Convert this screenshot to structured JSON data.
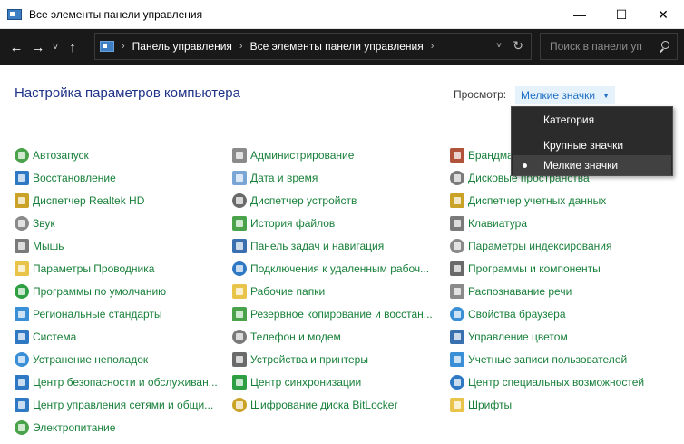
{
  "window": {
    "title": "Все элементы панели управления",
    "minimize": "—",
    "maximize": "☐",
    "close": "✕"
  },
  "address": {
    "back": "←",
    "forward": "→",
    "recent": "˅",
    "up": "↑",
    "crumbs": [
      "Панель управления",
      "Все элементы панели управления"
    ],
    "sep": "›",
    "dropdown": "˅",
    "refresh": "↻"
  },
  "search": {
    "placeholder": "Поиск в панели уп"
  },
  "header": {
    "title": "Настройка параметров компьютера",
    "view_label": "Просмотр:",
    "view_value": "Мелкие значки",
    "view_arrow": "▼"
  },
  "view_menu": {
    "items": [
      "Категория",
      "Крупные значки",
      "Мелкие значки"
    ],
    "selected": "Мелкие значки"
  },
  "columns": [
    [
      {
        "label": "Автозапуск",
        "icon": "autoplay-icon",
        "color": "#4aa34a"
      },
      {
        "label": "Восстановление",
        "icon": "recovery-icon",
        "color": "#2f78c4"
      },
      {
        "label": "Диспетчер Realtek HD",
        "icon": "realtek-audio-icon",
        "color": "#c9a227"
      },
      {
        "label": "Звук",
        "icon": "speaker-icon",
        "color": "#8a8a8a"
      },
      {
        "label": "Мышь",
        "icon": "mouse-icon",
        "color": "#7a7a7a"
      },
      {
        "label": "Параметры Проводника",
        "icon": "folder-options-icon",
        "color": "#e8c54a"
      },
      {
        "label": "Программы по умолчанию",
        "icon": "default-programs-icon",
        "color": "#2ea043"
      },
      {
        "label": "Региональные стандарты",
        "icon": "region-globe-icon",
        "color": "#3a8fd6"
      },
      {
        "label": "Система",
        "icon": "system-monitor-icon",
        "color": "#2f78c4"
      },
      {
        "label": "Устранение неполадок",
        "icon": "troubleshoot-icon",
        "color": "#3a8fd6"
      },
      {
        "label": "Центр безопасности и обслуживан...",
        "icon": "security-flag-icon",
        "color": "#2f78c4"
      },
      {
        "label": "Центр управления сетями и общи...",
        "icon": "network-icon",
        "color": "#2f78c4"
      },
      {
        "label": "Электропитание",
        "icon": "power-options-icon",
        "color": "#4aa34a"
      }
    ],
    [
      {
        "label": "Администрирование",
        "icon": "admin-tools-icon",
        "color": "#8a8a8a"
      },
      {
        "label": "Дата и время",
        "icon": "clock-icon",
        "color": "#7aa6d6"
      },
      {
        "label": "Диспетчер устройств",
        "icon": "device-manager-icon",
        "color": "#6a6a6a"
      },
      {
        "label": "История файлов",
        "icon": "file-history-icon",
        "color": "#4aa34a"
      },
      {
        "label": "Панель задач и навигация",
        "icon": "taskbar-icon",
        "color": "#3a6fb0"
      },
      {
        "label": "Подключения к удаленным рабоч...",
        "icon": "remote-desktop-icon",
        "color": "#2f78c4"
      },
      {
        "label": "Рабочие папки",
        "icon": "work-folders-icon",
        "color": "#e8c54a"
      },
      {
        "label": "Резервное копирование и восстан...",
        "icon": "backup-icon",
        "color": "#4aa34a"
      },
      {
        "label": "Телефон и модем",
        "icon": "phone-modem-icon",
        "color": "#7a7a7a"
      },
      {
        "label": "Устройства и принтеры",
        "icon": "printer-icon",
        "color": "#6a6a6a"
      },
      {
        "label": "Центр синхронизации",
        "icon": "sync-center-icon",
        "color": "#2ea043"
      },
      {
        "label": "Шифрование диска BitLocker",
        "icon": "bitlocker-key-icon",
        "color": "#c9a227"
      }
    ],
    [
      {
        "label": "Брандмауэр Защитника Windows",
        "icon": "firewall-icon",
        "color": "#b0533a"
      },
      {
        "label": "Дисковые пространства",
        "icon": "storage-spaces-icon",
        "color": "#7a7a7a"
      },
      {
        "label": "Диспетчер учетных данных",
        "icon": "credential-manager-icon",
        "color": "#c9a227"
      },
      {
        "label": "Клавиатура",
        "icon": "keyboard-icon",
        "color": "#7a7a7a"
      },
      {
        "label": "Параметры индексирования",
        "icon": "indexing-icon",
        "color": "#8a8a8a"
      },
      {
        "label": "Программы и компоненты",
        "icon": "programs-features-icon",
        "color": "#6a6a6a"
      },
      {
        "label": "Распознавание речи",
        "icon": "microphone-icon",
        "color": "#8a8a8a"
      },
      {
        "label": "Свойства браузера",
        "icon": "internet-options-icon",
        "color": "#3a8fd6"
      },
      {
        "label": "Управление цветом",
        "icon": "color-management-icon",
        "color": "#3a6fb0"
      },
      {
        "label": "Учетные записи пользователей",
        "icon": "user-accounts-icon",
        "color": "#3a8fd6"
      },
      {
        "label": "Центр специальных возможностей",
        "icon": "ease-of-access-icon",
        "color": "#2f78c4"
      },
      {
        "label": "Шрифты",
        "icon": "fonts-icon",
        "color": "#e8c54a"
      }
    ]
  ]
}
